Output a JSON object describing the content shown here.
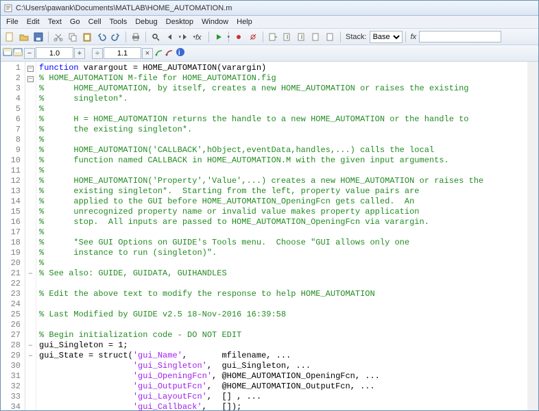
{
  "window": {
    "title": "C:\\Users\\pawank\\Documents\\MATLAB\\HOME_AUTOMATION.m"
  },
  "menu": {
    "items": [
      "File",
      "Edit",
      "Text",
      "Go",
      "Cell",
      "Tools",
      "Debug",
      "Desktop",
      "Window",
      "Help"
    ]
  },
  "toolbar": {
    "stack_label": "Stack:",
    "stack_value": "Base",
    "fx_label": "fx"
  },
  "toolbar2": {
    "zoom1": "1.0",
    "zoom2": "1.1"
  },
  "lines": [
    {
      "n": 1,
      "fold": "□",
      "seg": [
        {
          "c": "kw",
          "t": "function"
        },
        {
          "c": "",
          "t": " varargout = HOME_AUTOMATION(varargin)"
        }
      ]
    },
    {
      "n": 2,
      "fold": "□",
      "seg": [
        {
          "c": "cm",
          "t": "% HOME_AUTOMATION M-file for HOME_AUTOMATION.fig"
        }
      ]
    },
    {
      "n": 3,
      "seg": [
        {
          "c": "cm",
          "t": "%      HOME_AUTOMATION, by itself, creates a new HOME_AUTOMATION or raises the existing"
        }
      ]
    },
    {
      "n": 4,
      "seg": [
        {
          "c": "cm",
          "t": "%      singleton*."
        }
      ]
    },
    {
      "n": 5,
      "seg": [
        {
          "c": "cm",
          "t": "%"
        }
      ]
    },
    {
      "n": 6,
      "seg": [
        {
          "c": "cm",
          "t": "%      H = HOME_AUTOMATION returns the handle to a new HOME_AUTOMATION or the handle to"
        }
      ]
    },
    {
      "n": 7,
      "seg": [
        {
          "c": "cm",
          "t": "%      the existing singleton*."
        }
      ]
    },
    {
      "n": 8,
      "seg": [
        {
          "c": "cm",
          "t": "%"
        }
      ]
    },
    {
      "n": 9,
      "seg": [
        {
          "c": "cm",
          "t": "%      HOME_AUTOMATION('CALLBACK',hObject,eventData,handles,...) calls the local"
        }
      ]
    },
    {
      "n": 10,
      "seg": [
        {
          "c": "cm",
          "t": "%      function named CALLBACK in HOME_AUTOMATION.M with the given input arguments."
        }
      ]
    },
    {
      "n": 11,
      "seg": [
        {
          "c": "cm",
          "t": "%"
        }
      ]
    },
    {
      "n": 12,
      "seg": [
        {
          "c": "cm",
          "t": "%      HOME_AUTOMATION('Property','Value',...) creates a new HOME_AUTOMATION or raises the"
        }
      ]
    },
    {
      "n": 13,
      "seg": [
        {
          "c": "cm",
          "t": "%      existing singleton*.  Starting from the left, property value pairs are"
        }
      ]
    },
    {
      "n": 14,
      "seg": [
        {
          "c": "cm",
          "t": "%      applied to the GUI before HOME_AUTOMATION_OpeningFcn gets called.  An"
        }
      ]
    },
    {
      "n": 15,
      "seg": [
        {
          "c": "cm",
          "t": "%      unrecognized property name or invalid value makes property application"
        }
      ]
    },
    {
      "n": 16,
      "seg": [
        {
          "c": "cm",
          "t": "%      stop.  All inputs are passed to HOME_AUTOMATION_OpeningFcn via varargin."
        }
      ]
    },
    {
      "n": 17,
      "seg": [
        {
          "c": "cm",
          "t": "%"
        }
      ]
    },
    {
      "n": 18,
      "seg": [
        {
          "c": "cm",
          "t": "%      *See GUI Options on GUIDE's Tools menu.  Choose \"GUI allows only one"
        }
      ]
    },
    {
      "n": 19,
      "seg": [
        {
          "c": "cm",
          "t": "%      instance to run (singleton)\"."
        }
      ]
    },
    {
      "n": 20,
      "seg": [
        {
          "c": "cm",
          "t": "%"
        }
      ]
    },
    {
      "n": 21,
      "fold": "–",
      "seg": [
        {
          "c": "cm",
          "t": "% See also: GUIDE, GUIDATA, GUIHANDLES"
        }
      ]
    },
    {
      "n": 22,
      "seg": [
        {
          "c": "",
          "t": ""
        }
      ]
    },
    {
      "n": 23,
      "seg": [
        {
          "c": "cm",
          "t": "% Edit the above text to modify the response to help HOME_AUTOMATION"
        }
      ]
    },
    {
      "n": 24,
      "seg": [
        {
          "c": "",
          "t": ""
        }
      ]
    },
    {
      "n": 25,
      "seg": [
        {
          "c": "cm",
          "t": "% Last Modified by GUIDE v2.5 18-Nov-2016 16:39:58"
        }
      ]
    },
    {
      "n": 26,
      "seg": [
        {
          "c": "",
          "t": ""
        }
      ]
    },
    {
      "n": 27,
      "seg": [
        {
          "c": "cm",
          "t": "% Begin initialization code - DO NOT EDIT"
        }
      ]
    },
    {
      "n": 28,
      "fold": "–",
      "seg": [
        {
          "c": "",
          "t": "gui_Singleton = 1;"
        }
      ]
    },
    {
      "n": 29,
      "fold": "–",
      "seg": [
        {
          "c": "",
          "t": "gui_State = struct("
        },
        {
          "c": "str",
          "t": "'gui_Name'"
        },
        {
          "c": "",
          "t": ",       mfilename, ..."
        }
      ]
    },
    {
      "n": 30,
      "seg": [
        {
          "c": "",
          "t": "                   "
        },
        {
          "c": "str",
          "t": "'gui_Singleton'"
        },
        {
          "c": "",
          "t": ",  gui_Singleton, ..."
        }
      ]
    },
    {
      "n": 31,
      "seg": [
        {
          "c": "",
          "t": "                   "
        },
        {
          "c": "str",
          "t": "'gui_OpeningFcn'"
        },
        {
          "c": "",
          "t": ", @HOME_AUTOMATION_OpeningFcn, ..."
        }
      ]
    },
    {
      "n": 32,
      "seg": [
        {
          "c": "",
          "t": "                   "
        },
        {
          "c": "str",
          "t": "'gui_OutputFcn'"
        },
        {
          "c": "",
          "t": ",  @HOME_AUTOMATION_OutputFcn, ..."
        }
      ]
    },
    {
      "n": 33,
      "seg": [
        {
          "c": "",
          "t": "                   "
        },
        {
          "c": "str",
          "t": "'gui_LayoutFcn'"
        },
        {
          "c": "",
          "t": ",  [] , ..."
        }
      ]
    },
    {
      "n": 34,
      "seg": [
        {
          "c": "",
          "t": "                   "
        },
        {
          "c": "str",
          "t": "'gui_Callback'"
        },
        {
          "c": "",
          "t": ",   []);"
        }
      ]
    }
  ]
}
